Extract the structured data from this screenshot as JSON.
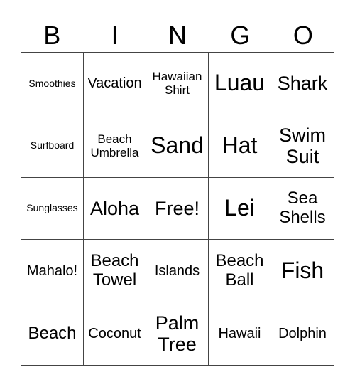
{
  "header": [
    "B",
    "I",
    "N",
    "G",
    "O"
  ],
  "cells": [
    {
      "text": "Smoothies",
      "size": "s1"
    },
    {
      "text": "Vacation",
      "size": "s3"
    },
    {
      "text": "Hawaiian Shirt",
      "size": "s2"
    },
    {
      "text": "Luau",
      "size": "s6"
    },
    {
      "text": "Shark",
      "size": "s5"
    },
    {
      "text": "Surfboard",
      "size": "s1"
    },
    {
      "text": "Beach Umbrella",
      "size": "s2"
    },
    {
      "text": "Sand",
      "size": "s6"
    },
    {
      "text": "Hat",
      "size": "s6"
    },
    {
      "text": "Swim Suit",
      "size": "s5"
    },
    {
      "text": "Sunglasses",
      "size": "s1"
    },
    {
      "text": "Aloha",
      "size": "s5"
    },
    {
      "text": "Free!",
      "size": "s5"
    },
    {
      "text": "Lei",
      "size": "s6"
    },
    {
      "text": "Sea Shells",
      "size": "s4"
    },
    {
      "text": "Mahalo!",
      "size": "s3"
    },
    {
      "text": "Beach Towel",
      "size": "s4"
    },
    {
      "text": "Islands",
      "size": "s3"
    },
    {
      "text": "Beach Ball",
      "size": "s4"
    },
    {
      "text": "Fish",
      "size": "s6"
    },
    {
      "text": "Beach",
      "size": "s4"
    },
    {
      "text": "Coconut",
      "size": "s3"
    },
    {
      "text": "Palm Tree",
      "size": "s5"
    },
    {
      "text": "Hawaii",
      "size": "s3"
    },
    {
      "text": "Dolphin",
      "size": "s3"
    }
  ]
}
